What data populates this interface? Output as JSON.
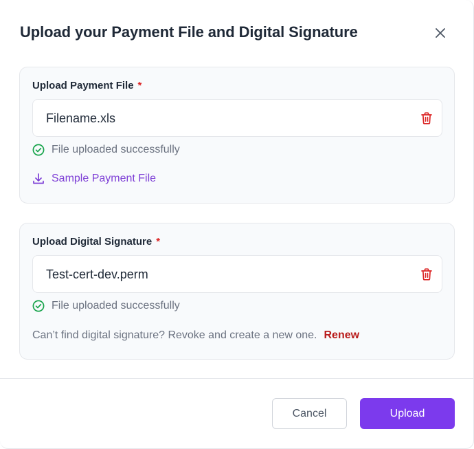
{
  "modal": {
    "title": "Upload your Payment File and Digital Signature",
    "close_icon": "close-icon"
  },
  "payment_section": {
    "label": "Upload Payment File",
    "required": "*",
    "file_name": "Filename.xls",
    "delete_icon": "trash-icon",
    "status_icon": "check-circle-icon",
    "status_text": "File uploaded successfully",
    "sample_icon": "download-icon",
    "sample_link": "Sample Payment File"
  },
  "signature_section": {
    "label": "Upload Digital Signature",
    "required": "*",
    "file_name": "Test-cert-dev.perm",
    "delete_icon": "trash-icon",
    "status_icon": "check-circle-icon",
    "status_text": "File uploaded successfully",
    "help_text": "Can’t find digital signature? Revoke and create a new one.",
    "renew_link": "Renew"
  },
  "footer": {
    "cancel_label": "Cancel",
    "upload_label": "Upload"
  },
  "colors": {
    "primary": "#7c3aed",
    "success": "#16a34a",
    "danger": "#dc2626",
    "link_purple": "#7e3fd6"
  }
}
